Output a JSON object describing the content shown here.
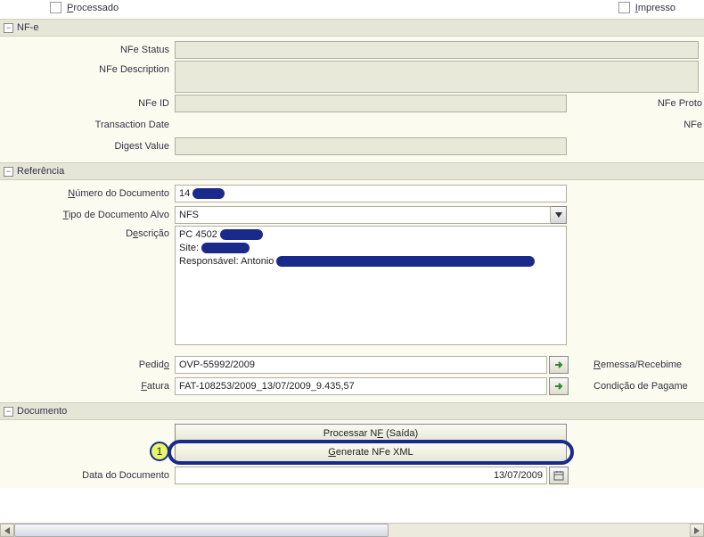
{
  "top": {
    "processado": "Processado",
    "impresso": "Impresso"
  },
  "sections": {
    "nfe": "NF-e",
    "referencia": "Referência",
    "documento": "Documento"
  },
  "nfe": {
    "status_label": "NFe Status",
    "description_label": "NFe Description",
    "id_label": "NFe ID",
    "transaction_date_label": "Transaction Date",
    "digest_value_label": "Digest Value",
    "proto_label": "NFe Proto",
    "nfe_right_label": "NFe"
  },
  "ref": {
    "num_doc_label": "Número do Documento",
    "num_doc_value": "14",
    "tipo_doc_label": "Tipo de Documento Alvo",
    "tipo_doc_value": "NFS",
    "descricao_label": "Descrição",
    "desc_line1_prefix": "PC 4502",
    "desc_line2_prefix": "Site:",
    "desc_line3_prefix": "Responsável: Antonio",
    "pedido_label": "Pedido",
    "pedido_value": "OVP-55992/2009",
    "fatura_label": "Fatura",
    "fatura_value": "FAT-108253/2009_13/07/2009_9.435,57",
    "remessa_label": "Remessa/Recebime",
    "condicao_label": "Condição de Pagame"
  },
  "buttons": {
    "processar_nf": "Processar NF (Saída)",
    "generate_xml": "Generate NFe XML"
  },
  "doc": {
    "data_label": "Data do Documento",
    "data_value": "13/07/2009"
  },
  "callout": {
    "num": "1"
  }
}
